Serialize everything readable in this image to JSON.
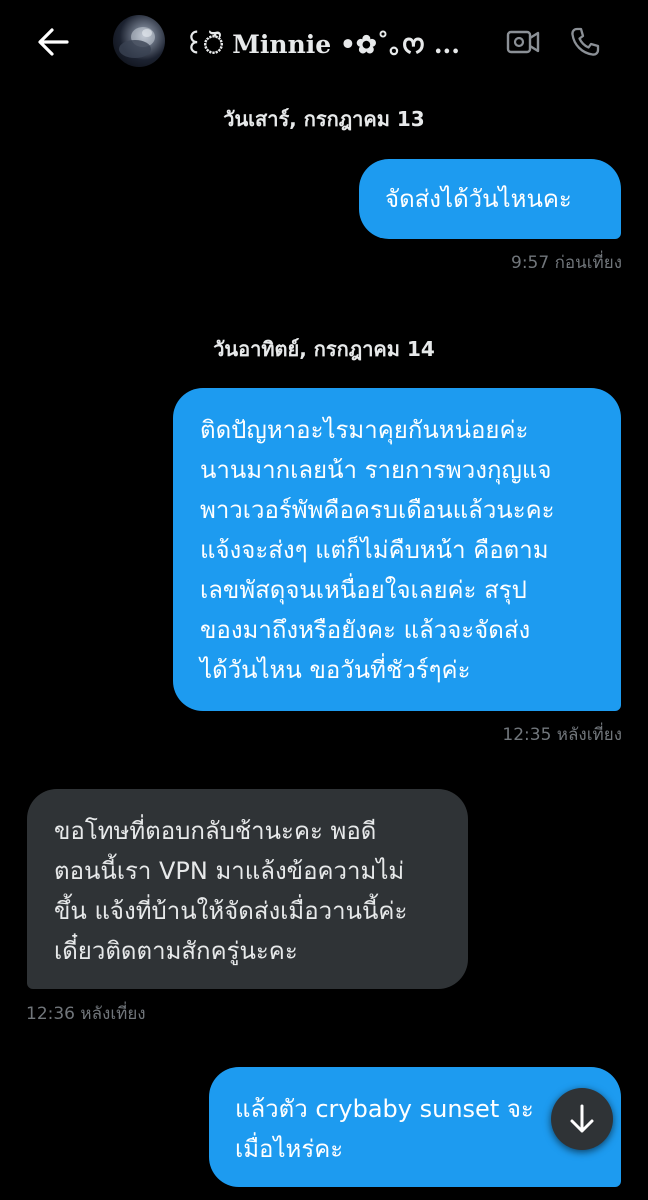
{
  "header": {
    "contact_name": "꒰ੌ Minnie •✿˚｡ᰔ ...",
    "back_icon": "arrow-left-icon",
    "video_icon": "video-camera-icon",
    "call_icon": "phone-icon"
  },
  "conversation": {
    "date_1": "วันเสาร์, กรกฎาคม 13",
    "msg_1": {
      "text": "จัดส่งได้วันไหนคะ",
      "time": "9:57 ก่อนเที่ยง"
    },
    "date_2": "วันอาทิตย์, กรกฎาคม 14",
    "msg_2": {
      "text": "ติดปัญหาอะไรมาคุยกันหน่อยค่ะ\nนานมากเลยน้า รายการพวงกุญแจ\nพาวเวอร์พัพคือครบเดือนแล้วนะคะ\nแจ้งจะส่งๆ แต่ก็ไม่คืบหน้า คือตาม\nเลขพัสดุจนเหนื่อยใจเลยค่ะ สรุป\nของมาถึงหรือยังคะ แล้วจะจัดส่ง\nได้วันไหน ขอวันที่ชัวร์ๆค่ะ",
      "time": "12:35 หลังเที่ยง"
    },
    "msg_3": {
      "text": "ขอโทษที่ตอบกลับช้านะคะ พอดี\nตอนนี้เรา VPN มาแล้งข้อความไม่\nขึ้น แจ้งที่บ้านให้จัดส่งเมื่อวานนี้ค่ะ\nเดี๋ยวติดตามสักครู่นะคะ",
      "time": "12:36 หลังเที่ยง"
    },
    "msg_4": {
      "text": "แล้วตัว crybaby sunset จะ\nเมื่อไหร่คะ"
    }
  },
  "scroll_down_icon": "arrow-down-icon",
  "colors": {
    "background": "#000000",
    "outgoing_bubble": "#1d9bf0",
    "incoming_bubble": "#2f3336",
    "timestamp": "#71767b"
  }
}
